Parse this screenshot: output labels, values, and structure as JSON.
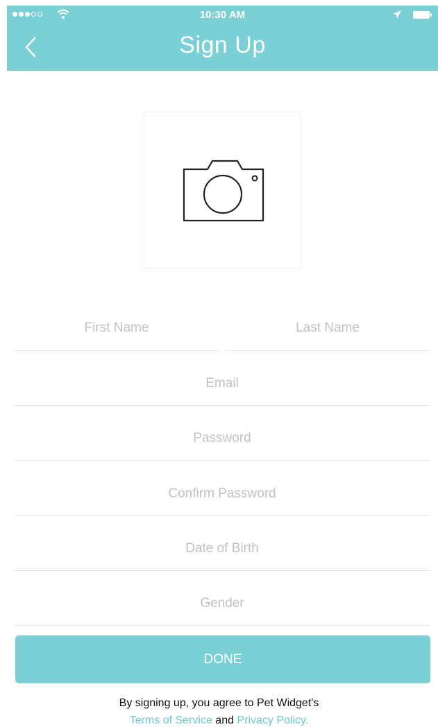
{
  "status_bar": {
    "time": "10:30 AM",
    "signal_icon": "signal-dots-icon",
    "wifi_icon": "wifi-icon",
    "location_icon": "location-arrow-icon",
    "battery_icon": "battery-icon"
  },
  "header": {
    "title": "Sign Up",
    "back_icon": "chevron-left-icon",
    "background_color": "#7ad0d4"
  },
  "photo": {
    "icon": "camera-icon"
  },
  "form": {
    "first_name_placeholder": "First Name",
    "last_name_placeholder": "Last Name",
    "email_placeholder": "Email",
    "password_placeholder": "Password",
    "confirm_password_placeholder": "Confirm Password",
    "date_of_birth_placeholder": "Date of Birth",
    "gender_placeholder": "Gender"
  },
  "done_button": {
    "label": "DONE"
  },
  "legal": {
    "prefix": "By signing up, you agree to Pet Widget's",
    "terms_link": "Terms of Service",
    "and": "and",
    "privacy_link": "Privacy Policy."
  },
  "colors": {
    "accent": "#7ad0d4",
    "link": "#6ec9cd",
    "placeholder": "#c2c2c2"
  }
}
